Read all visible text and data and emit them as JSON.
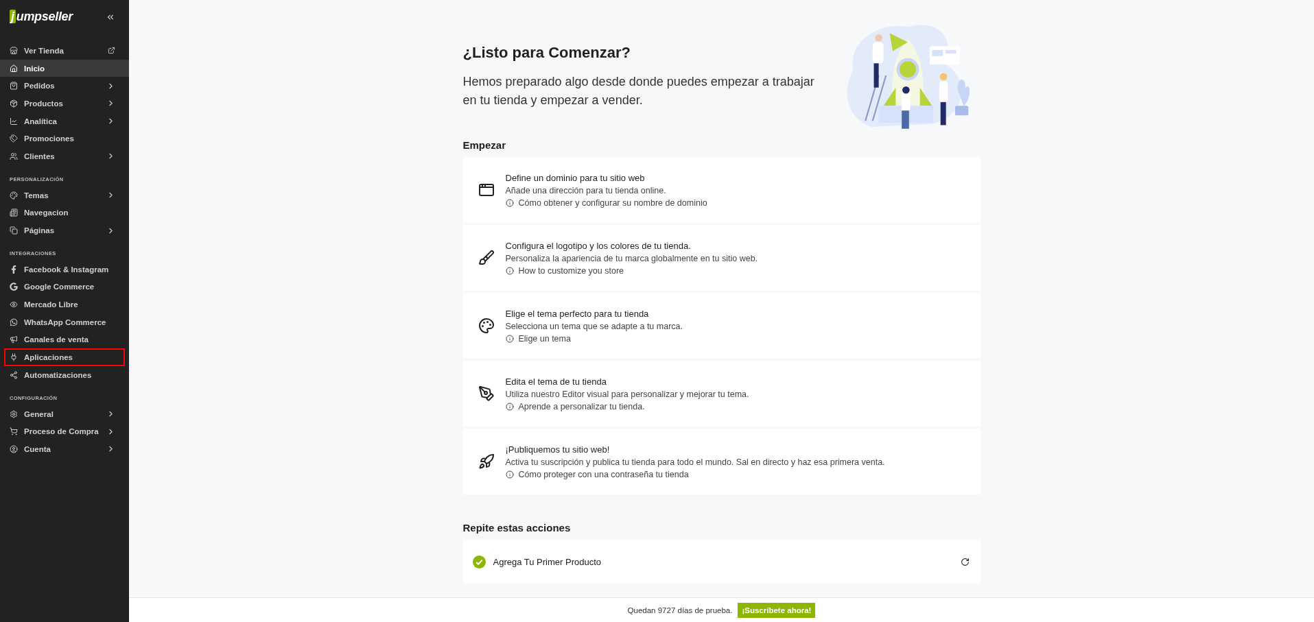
{
  "sidebar": {
    "logo": "jumpseller",
    "sections": [
      {
        "items": [
          {
            "label": "Ver Tienda",
            "kind": "external",
            "selected": false,
            "outlined": false
          },
          {
            "label": "Inicio",
            "kind": "plain",
            "selected": true,
            "outlined": false
          },
          {
            "label": "Pedidos",
            "kind": "submenu",
            "selected": false,
            "outlined": false
          },
          {
            "label": "Productos",
            "kind": "submenu",
            "selected": false,
            "outlined": false
          },
          {
            "label": "Analítica",
            "kind": "submenu",
            "selected": false,
            "outlined": false
          },
          {
            "label": "Promociones",
            "kind": "plain",
            "selected": false,
            "outlined": false
          },
          {
            "label": "Clientes",
            "kind": "submenu",
            "selected": false,
            "outlined": false
          }
        ]
      },
      {
        "title": "PERSONALIZACIÓN",
        "items": [
          {
            "label": "Temas",
            "kind": "submenu",
            "selected": false,
            "outlined": false
          },
          {
            "label": "Navegacion",
            "kind": "plain",
            "selected": false,
            "outlined": false
          },
          {
            "label": "Páginas",
            "kind": "submenu",
            "selected": false,
            "outlined": false
          }
        ]
      },
      {
        "title": "INTEGRACIONES",
        "items": [
          {
            "label": "Facebook & Instagram",
            "kind": "plain",
            "selected": false,
            "outlined": false
          },
          {
            "label": "Google Commerce",
            "kind": "plain",
            "selected": false,
            "outlined": false
          },
          {
            "label": "Mercado Libre",
            "kind": "plain",
            "selected": false,
            "outlined": false
          },
          {
            "label": "WhatsApp Commerce",
            "kind": "plain",
            "selected": false,
            "outlined": false
          },
          {
            "label": "Canales de venta",
            "kind": "plain",
            "selected": false,
            "outlined": false
          },
          {
            "label": "Aplicaciones",
            "kind": "plain",
            "selected": false,
            "outlined": true
          },
          {
            "label": "Automatizaciones",
            "kind": "plain",
            "selected": false,
            "outlined": false
          }
        ]
      },
      {
        "title": "CONFIGURACIÓN",
        "items": [
          {
            "label": "General",
            "kind": "submenu",
            "selected": false,
            "outlined": false
          },
          {
            "label": "Proceso de Compra",
            "kind": "submenu",
            "selected": false,
            "outlined": false
          },
          {
            "label": "Cuenta",
            "kind": "submenu",
            "selected": false,
            "outlined": false
          }
        ]
      }
    ]
  },
  "hero": {
    "title": "¿Listo para Comenzar?",
    "subtitle": "Hemos preparado algo desde donde puedes empezar a trabajar en tu tienda y empezar a vender."
  },
  "start": {
    "heading": "Empezar",
    "tasks": [
      {
        "title": "Define un dominio para tu sitio web",
        "description": "Añade una dirección para tu tienda online.",
        "help": "Cómo obtener y configurar su nombre de dominio"
      },
      {
        "title": "Configura el logotipo y los colores de tu tienda.",
        "description": "Personaliza la apariencia de tu marca globalmente en tu sitio web.",
        "help": "How to customize you store"
      },
      {
        "title": "Elige el tema perfecto para tu tienda",
        "description": "Selecciona un tema que se adapte a tu marca.",
        "help": "Elige un tema"
      },
      {
        "title": "Edita el tema de tu tienda",
        "description": "Utiliza nuestro Editor visual para personalizar y mejorar tu tema.",
        "help": "Aprende a personalizar tu tienda."
      },
      {
        "title": "¡Publiquemos tu sitio web!",
        "description": "Activa tu suscripción y publica tu tienda para todo el mundo. Sal en directo y haz esa primera venta.",
        "help": "Cómo proteger con una contraseña tu tienda"
      }
    ]
  },
  "repeat": {
    "heading": "Repite estas acciones",
    "actions": [
      {
        "label": "Agrega Tu Primer Producto",
        "done": true
      }
    ]
  },
  "trial_bar": {
    "text": "Quedan 9727 días de prueba.",
    "button": "¡Suscríbete ahora!"
  }
}
